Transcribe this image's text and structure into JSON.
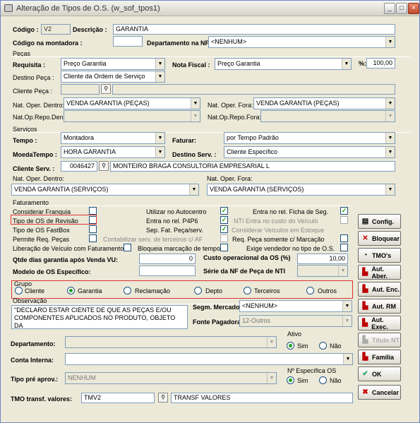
{
  "window": {
    "title": "Alteração de Tipos de O.S. (w_sof_tpos1)",
    "min": "_",
    "max": "□",
    "close": "×"
  },
  "codigo": {
    "label": "Código :",
    "value": "V2"
  },
  "descricao": {
    "label": "Descrição :",
    "value": "GARANTIA"
  },
  "codmontadora": {
    "label": "Código na montadora :",
    "value": ""
  },
  "depnf": {
    "label": "Departamento na NF:",
    "value": "<NENHUM>"
  },
  "pecas": {
    "title": "Peças",
    "requisita_label": "Requisita :",
    "requisita": "Preço Garantia",
    "notafiscal_label": "Nota Fiscal :",
    "notafiscal": "Preço Garantia",
    "pct_label": "%:",
    "pct": "100,00",
    "destino_label": "Destino Peça :",
    "destino": "Cliente da Ordem de Serviço",
    "cliente_label": "Cliente Peça :",
    "natdentro_label": "Nat. Oper. Dentro:",
    "natdentro": "VENDA GARANTIA (PEÇAS)",
    "natfora_label": "Nat. Oper. Fora:",
    "natfora": "VENDA GARANTIA (PEÇAS)",
    "reden_label": "Nat.Op.Repo.Den:",
    "refora_label": "Nat.Op.Repo.Fora:"
  },
  "servicos": {
    "title": "Serviços",
    "tempo_label": "Tempo :",
    "tempo": "Montadora",
    "faturar_label": "Faturar:",
    "faturar": "por Tempo Padrão",
    "moeda_label": "MoedaTempo :",
    "moeda": "HORA GARANTIA",
    "destino_label": "Destino Serv. :",
    "destino": "Cliente Específico",
    "cliente_label": "Cliente Serv. :",
    "cliente_cod": "0046427",
    "cliente_nome": "MONTEIRO BRAGA CONSULTORIA EMPRESARIAL L",
    "natdentro_label": "Nat. Oper. Dentro:",
    "natdentro": "VENDA GARANTIA (SERVIÇOS)",
    "natfora_label": "Nat. Oper. Fora:",
    "natfora": "VENDA GARANTIA (SERVIÇOS)"
  },
  "faturamento": {
    "title": "Faturamento",
    "considerar": "Considerar Franquia",
    "tipo_revisao": "Tipo de OS de Revisão",
    "tipo_fastbox": "Tipo de OS FastBox",
    "permite": "Permite Req. Peças",
    "liberacao": "Liberação de Veículo com Faturamento",
    "utilizar": "Utilizar no Autocentro",
    "entra_p4p6": "Entra no rel. P4P6",
    "sep_fat": "Sep. Fat. Peça/serv.",
    "contabilizar": "Contabilizar serv. de terceiros c/ AF",
    "bloqueia": "Bloqueia marcação de tempo",
    "entra_ficha": "Entra no rel. Ficha de Seg.",
    "nti_entra": "NTI Entra no custo do Veículo",
    "considerar_estoque": "Considerar Veículos em Estoque",
    "req_peca": "Req. Peça somente c/ Marcação",
    "exige": "Exige vendedor no tipo de O.S.",
    "qtde_label": "Qtde dias garantia após Venda VU:",
    "qtde": "0",
    "custo_label": "Custo operacional da OS (%)",
    "custo": "10,00",
    "modelo_label": "Modelo de OS Específico:",
    "serie_label": "Série da NF de Peça de NTI"
  },
  "grupo": {
    "title": "Grupo",
    "options": [
      "Cliente",
      "Garantia",
      "Reclamação",
      "Depto",
      "Terceiros",
      "Outros"
    ]
  },
  "observacao": {
    "title": "Observação",
    "text": "\"DECLARO ESTAR CIENTE DE QUE AS PEÇAS E/OU COMPONENTES APLICADOS NO PRODUTO, OBJETO DA",
    "segm_label": "Segm. Mercado:",
    "segm": "<NENHUM>",
    "fonte_label": "Fonte Pagadora:",
    "fonte": "12-Outros"
  },
  "departamento_label": "Departamento:",
  "ativo": {
    "label": "Ativo",
    "sim": "Sim",
    "nao": "Não"
  },
  "conta_label": "Conta Interna:",
  "tipopre": {
    "label": "Tipo pré aprov.:",
    "value": "NENHUM"
  },
  "nespecifica": {
    "label": "Nº Específica OS",
    "sim": "Sim",
    "nao": "Não"
  },
  "tmo": {
    "label": "TMO transf. valores:",
    "value": "TMV2",
    "desc": "TRANSF VALORES"
  },
  "buttons": [
    "Config.",
    "Bloquear",
    "TMO's",
    "Aut. Aber.",
    "Aut. Enc.",
    "Aut. RM",
    "Aut. Exec.",
    "Título NT",
    "Família",
    "OK",
    "Cancelar"
  ]
}
